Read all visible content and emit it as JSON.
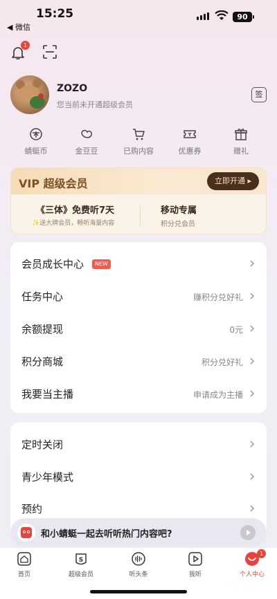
{
  "status_bar": {
    "time": "15:25",
    "back_label": "◀ 微信",
    "battery": "90"
  },
  "notifications": {
    "badge": "1"
  },
  "profile": {
    "name": "ZOZO",
    "subtitle": "您当前未开通超级会员",
    "sign_label": "签"
  },
  "quick_entries": [
    {
      "label": "蜻蜓币",
      "icon": "dragonfly-coin-icon"
    },
    {
      "label": "金豆豆",
      "icon": "bean-icon"
    },
    {
      "label": "已购内容",
      "icon": "cart-icon"
    },
    {
      "label": "优惠券",
      "icon": "coupon-icon"
    },
    {
      "label": "赠礼",
      "icon": "gift-icon"
    }
  ],
  "vip_card": {
    "title": "VIP 超级会员",
    "button": "立即开通 ▸",
    "left_title": "《三体》免费听7天",
    "left_sub": "✨送大牌会员，畅听海量内容",
    "right_title": "移动专属",
    "right_sub": "积分兑会员"
  },
  "menu_group_1": [
    {
      "label": "会员成长中心",
      "value": "",
      "badge": "NEW"
    },
    {
      "label": "任务中心",
      "value": "赚积分兑好礼"
    },
    {
      "label": "余额提现",
      "value": "0元"
    },
    {
      "label": "积分商城",
      "value": "积分兑好礼"
    },
    {
      "label": "我要当主播",
      "value": "申请成为主播"
    }
  ],
  "menu_group_2": [
    {
      "label": "定时关闭"
    },
    {
      "label": "青少年模式"
    },
    {
      "label": "预约"
    }
  ],
  "prompt": {
    "text": "和小蜻蜓一起去听听热门内容吧?"
  },
  "tabbar": [
    {
      "label": "首页",
      "icon": "home-icon"
    },
    {
      "label": "超级会员",
      "icon": "vip-icon"
    },
    {
      "label": "听头条",
      "icon": "headline-icon"
    },
    {
      "label": "我听",
      "icon": "play-list-icon"
    },
    {
      "label": "个人中心",
      "icon": "profile-icon",
      "badge": "1",
      "active": true
    }
  ],
  "colors": {
    "accent": "#e8443c",
    "vip_brown": "#4a2f1e",
    "vip_gold": "#f5dcb7"
  }
}
